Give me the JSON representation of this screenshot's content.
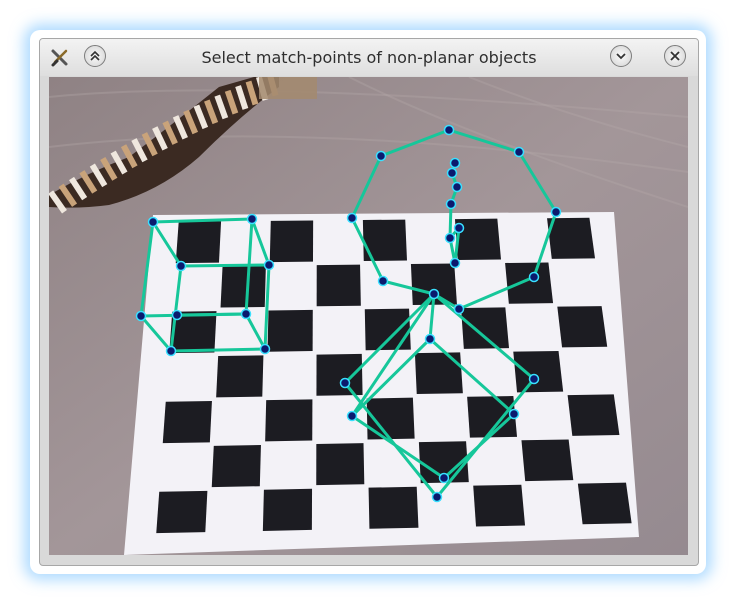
{
  "window": {
    "title": "Select match-points of non-planar objects"
  },
  "icons": {
    "app": "tools-icon",
    "shade": "shade-up-icon",
    "minimize": "minimize-icon",
    "close": "close-icon"
  },
  "colors": {
    "overlay_line": "#16c79a",
    "point_fill": "#0b1a6e",
    "point_ring": "#39e0ff",
    "board_dark": "#1c1c22",
    "board_light": "#f3f2f7"
  }
}
